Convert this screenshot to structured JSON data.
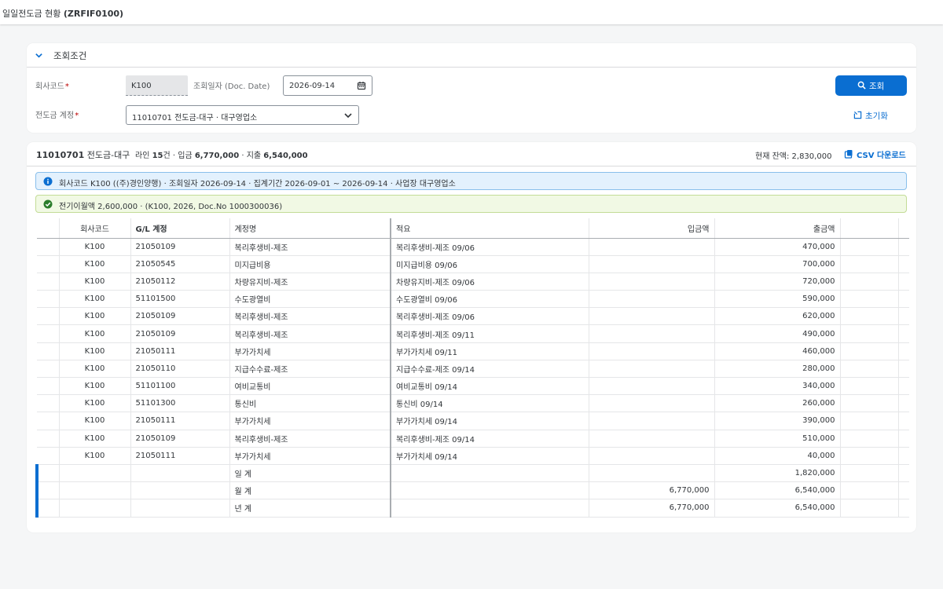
{
  "shell": {
    "title_prefix": "일일전도금 현황 ",
    "title_code": "(ZRFIF0100)"
  },
  "filter": {
    "section_title": "조회조건",
    "company_code": {
      "label": "회사코드",
      "value": "K100"
    },
    "doc_date": {
      "label": "조회일자 (Doc. Date)",
      "value": "2026-09-14"
    },
    "advance_account": {
      "label": "전도금 계정",
      "value": "11010701 전도금-대구 · 대구영업소"
    },
    "search_button": "조회",
    "reset_button": "초기화"
  },
  "result": {
    "account_title": "11010701",
    "account_name": "전도금-대구",
    "summary_prefix": "라인 ",
    "line_count": "15",
    "summary_mid1": "건 · 입금 ",
    "deposit_total": "6,770,000",
    "summary_mid2": " · 지출 ",
    "withdrawal_total": "6,540,000",
    "balance_label": "현재 잔액: ",
    "balance_value": "2,830,000",
    "csv_button": "CSV 다운로드",
    "info_message": "회사코드 K100 ((주)경인양행) · 조회일자 2026-09-14 · 집계기간 2026-09-01 ~ 2026-09-14 · 사업장 대구영업소",
    "success_message": "전기이월액 2,600,000 · (K100, 2026, Doc.No 1000300036)"
  },
  "table": {
    "headers": {
      "company": "회사코드",
      "gl": "G/L 계정",
      "acct_name": "계정명",
      "memo": "적요",
      "deposit": "입금액",
      "withdrawal": "출금액"
    },
    "rows": [
      {
        "company": "K100",
        "gl": "21050109",
        "name": "복리후생비-제조",
        "memo": "복리후생비-제조 09/06",
        "deposit": "",
        "withdrawal": "470,000"
      },
      {
        "company": "K100",
        "gl": "21050545",
        "name": "미지급비용",
        "memo": "미지급비용 09/06",
        "deposit": "",
        "withdrawal": "700,000"
      },
      {
        "company": "K100",
        "gl": "21050112",
        "name": "차량유지비-제조",
        "memo": "차량유지비-제조 09/06",
        "deposit": "",
        "withdrawal": "720,000"
      },
      {
        "company": "K100",
        "gl": "51101500",
        "name": "수도광열비",
        "memo": "수도광열비 09/06",
        "deposit": "",
        "withdrawal": "590,000"
      },
      {
        "company": "K100",
        "gl": "21050109",
        "name": "복리후생비-제조",
        "memo": "복리후생비-제조 09/06",
        "deposit": "",
        "withdrawal": "620,000"
      },
      {
        "company": "K100",
        "gl": "21050109",
        "name": "복리후생비-제조",
        "memo": "복리후생비-제조 09/11",
        "deposit": "",
        "withdrawal": "490,000"
      },
      {
        "company": "K100",
        "gl": "21050111",
        "name": "부가가치세",
        "memo": "부가가치세 09/11",
        "deposit": "",
        "withdrawal": "460,000"
      },
      {
        "company": "K100",
        "gl": "21050110",
        "name": "지급수수료-제조",
        "memo": "지급수수료-제조 09/14",
        "deposit": "",
        "withdrawal": "280,000"
      },
      {
        "company": "K100",
        "gl": "51101100",
        "name": "여비교통비",
        "memo": "여비교통비 09/14",
        "deposit": "",
        "withdrawal": "340,000"
      },
      {
        "company": "K100",
        "gl": "51101300",
        "name": "통신비",
        "memo": "통신비 09/14",
        "deposit": "",
        "withdrawal": "260,000"
      },
      {
        "company": "K100",
        "gl": "21050111",
        "name": "부가가치세",
        "memo": "부가가치세 09/14",
        "deposit": "",
        "withdrawal": "390,000"
      },
      {
        "company": "K100",
        "gl": "21050109",
        "name": "복리후생비-제조",
        "memo": "복리후생비-제조 09/14",
        "deposit": "",
        "withdrawal": "510,000"
      },
      {
        "company": "K100",
        "gl": "21050111",
        "name": "부가가치세",
        "memo": "부가가치세 09/14",
        "deposit": "",
        "withdrawal": "40,000"
      }
    ],
    "totals": [
      {
        "label": "일 계",
        "deposit": "",
        "withdrawal": "1,820,000"
      },
      {
        "label": "월 계",
        "deposit": "6,770,000",
        "withdrawal": "6,540,000"
      },
      {
        "label": "년 계",
        "deposit": "6,770,000",
        "withdrawal": "6,540,000"
      }
    ]
  },
  "colors": {
    "primary": "#0a6ed1",
    "required": "#bb0000",
    "info_bg": "#e3f1fd",
    "success_bg": "#f1f9e4",
    "success_icon": "#2b7d2b"
  }
}
